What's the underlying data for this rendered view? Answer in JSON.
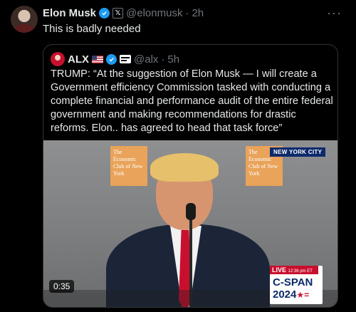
{
  "tweet": {
    "author_name": "Elon Musk",
    "handle": "@elonmusk",
    "separator": "·",
    "time": "2h",
    "text": "This is badly needed",
    "more_icon": "more-horizontal-icon"
  },
  "quoted_tweet": {
    "author_name": "ALX",
    "handle": "@alx",
    "separator": "·",
    "time": "5h",
    "text": "TRUMP: “At the suggestion of Elon Musk — I will create a Government efficiency Commission tasked with conducting a complete financial and performance audit of the entire federal government and making recommendations for drastic reforms. Elon.. has agreed to head that task force”",
    "video": {
      "duration": "0:35",
      "location_banner": "NEW YORK CITY",
      "sign_text": "The Economic Club of New York",
      "live_label": "LIVE",
      "live_time": "12:36 pm ET",
      "network": "C-SPAN",
      "year": "2024",
      "year_mark": "★="
    }
  },
  "colors": {
    "background": "#000000",
    "text": "#e7e9ea",
    "muted": "#71767b",
    "verified_blue": "#1d9bf0",
    "border": "#2f3336"
  },
  "icons": {
    "verified": "verified-badge-icon",
    "x_affiliation": "x-logo-icon",
    "flag": "us-flag-icon"
  }
}
